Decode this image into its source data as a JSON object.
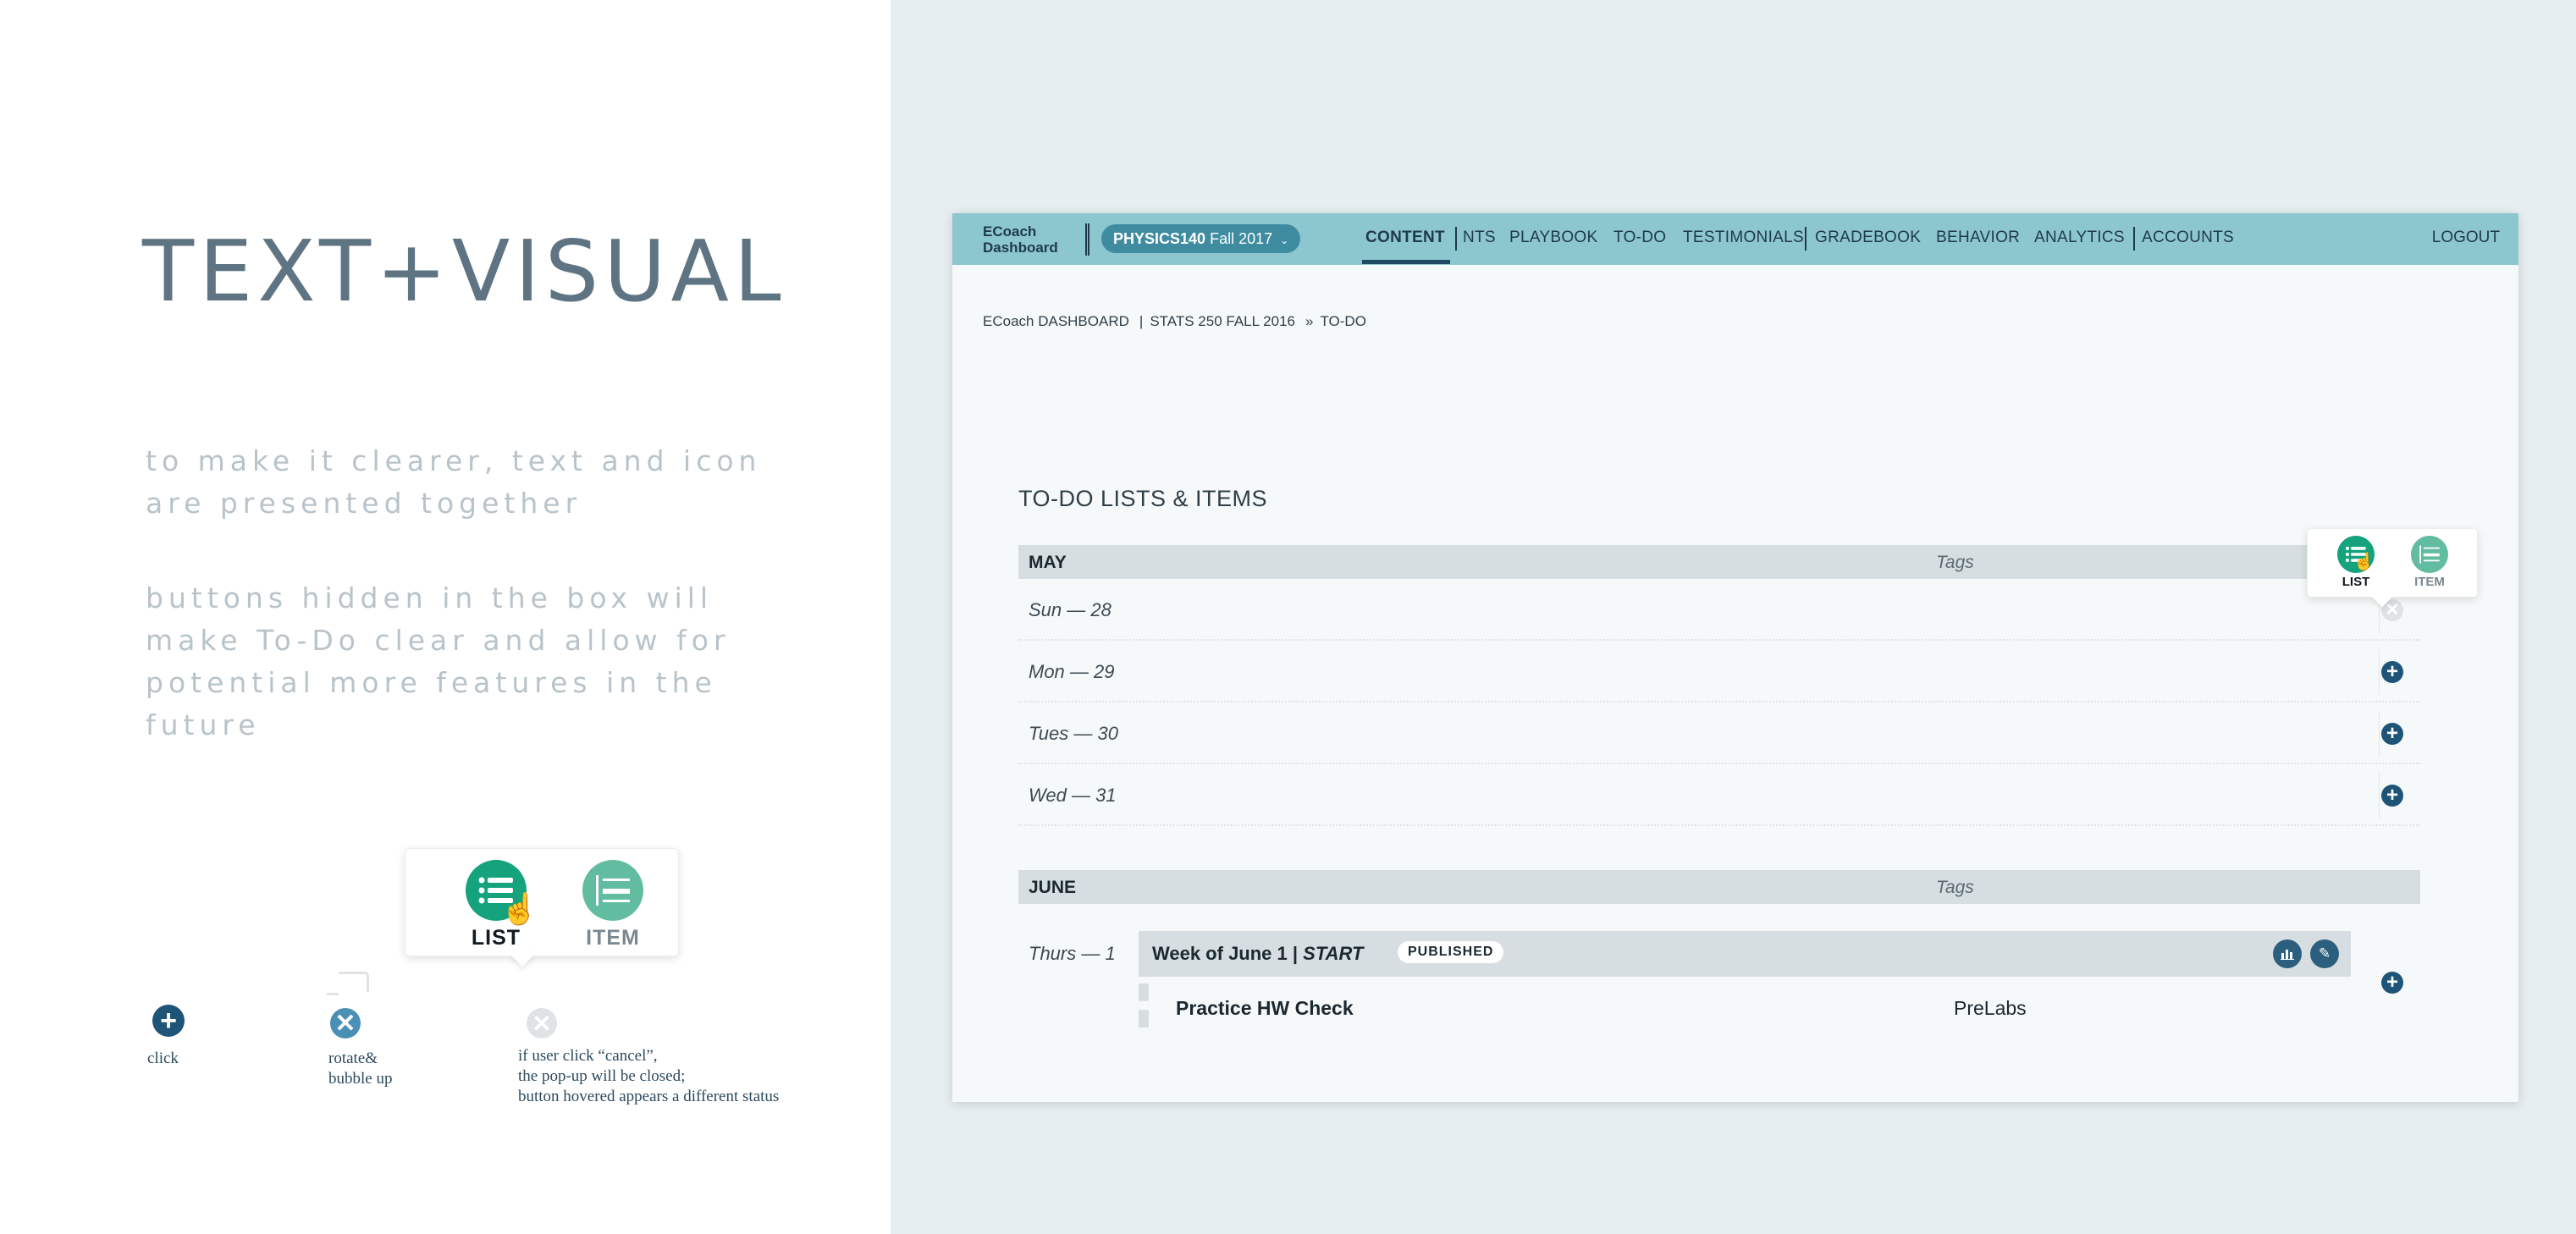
{
  "left": {
    "title": "TEXT+VISUAL",
    "note1": "to make it clearer, text and icon are presented together",
    "note2": "buttons hidden in the box will make To-Do clear and allow for potential more features in the future",
    "popup": {
      "list_label": "LIST",
      "item_label": "ITEM"
    },
    "steps": {
      "click": "click",
      "rotate_line1": "rotate&",
      "rotate_line2": "bubble up",
      "cancel_line1": "if user click “cancel”,",
      "cancel_line2": "the pop-up will be closed;",
      "cancel_line3": "button hovered appears a different status"
    }
  },
  "app": {
    "brand_line1": "ECoach",
    "brand_line2": "Dashboard",
    "course": {
      "code": "PHYSICS140",
      "term": "Fall 2017"
    },
    "nav": [
      "CONTENT",
      "NTS",
      "PLAYBOOK",
      "TO-DO",
      "TESTIMONIALS",
      "GRADEBOOK",
      "BEHAVIOR",
      "ANALYTICS",
      "ACCOUNTS"
    ],
    "active_nav": "CONTENT",
    "logout": "LOGOUT",
    "breadcrumb": [
      "ECoach DASHBOARD",
      "STATS 250 FALL 2016",
      "TO-DO"
    ],
    "section_title": "TO-DO LISTS & ITEMS",
    "may": {
      "month": "MAY",
      "tags_header": "Tags",
      "days": [
        "Sun — 28",
        "Mon — 29",
        "Tues — 30",
        "Wed — 31"
      ]
    },
    "june": {
      "month": "JUNE",
      "tags_header": "Tags",
      "day": "Thurs — 1",
      "week_title": "Week of June 1 | ",
      "week_title_em": "START",
      "status": "PUBLISHED",
      "item": "Practice HW Check",
      "item_tag": "PreLabs"
    },
    "popup": {
      "list_label": "LIST",
      "item_label": "ITEM"
    }
  },
  "colors": {
    "navbar": "#8cc6cf",
    "accent_green": "#14a37c",
    "accent_green_light": "#62bc9f",
    "add_button": "#1e5478",
    "disabled": "#dfe3e5",
    "title": "#5f7482"
  }
}
